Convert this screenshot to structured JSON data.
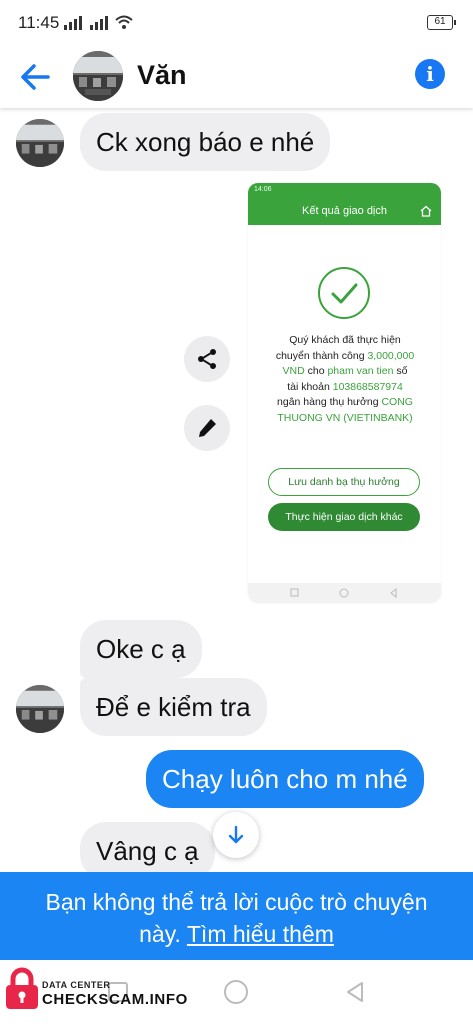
{
  "status_bar": {
    "time": "11:45",
    "battery": "61"
  },
  "header": {
    "contact_name": "Văn"
  },
  "messages": [
    {
      "text": "Ck xong báo e nhé",
      "direction": "incoming"
    },
    {
      "text": "Oke c ạ",
      "direction": "incoming"
    },
    {
      "text": "Để e kiểm tra",
      "direction": "incoming"
    },
    {
      "text": "Chạy luôn cho m nhé",
      "direction": "outgoing"
    },
    {
      "text": "Vâng c ạ",
      "direction": "incoming"
    }
  ],
  "shared_screenshot": {
    "status_time": "14:06",
    "title": "Kết quả giao dịch",
    "line1": "Quý khách đã thực hiện",
    "line2_a": "chuyển thành công ",
    "amount": "3,000,000",
    "currency": "VND",
    "line3_b": " cho ",
    "recipient": "pham van tien",
    "line3_c": " số",
    "line4_a": "tài khoản ",
    "account": "103868587974",
    "line5_a": "ngân hàng thụ hưởng ",
    "bank_1": "CONG",
    "bank_2": "THUONG VN (VIETINBANK)",
    "button_save": "Lưu danh bạ thụ hưởng",
    "button_new": "Thực hiện giao dịch khác"
  },
  "notice": {
    "text": "Bạn không thể trả lời cuộc trò chuyện",
    "text2": "này. ",
    "link": "Tìm hiểu thêm"
  },
  "watermark": {
    "small": "DATA CENTER",
    "big": "CHECKSCAM.INFO"
  },
  "colors": {
    "messenger_blue": "#1a85f3",
    "bubble_gray": "#eeeef0",
    "bank_green": "#3aa33c"
  }
}
